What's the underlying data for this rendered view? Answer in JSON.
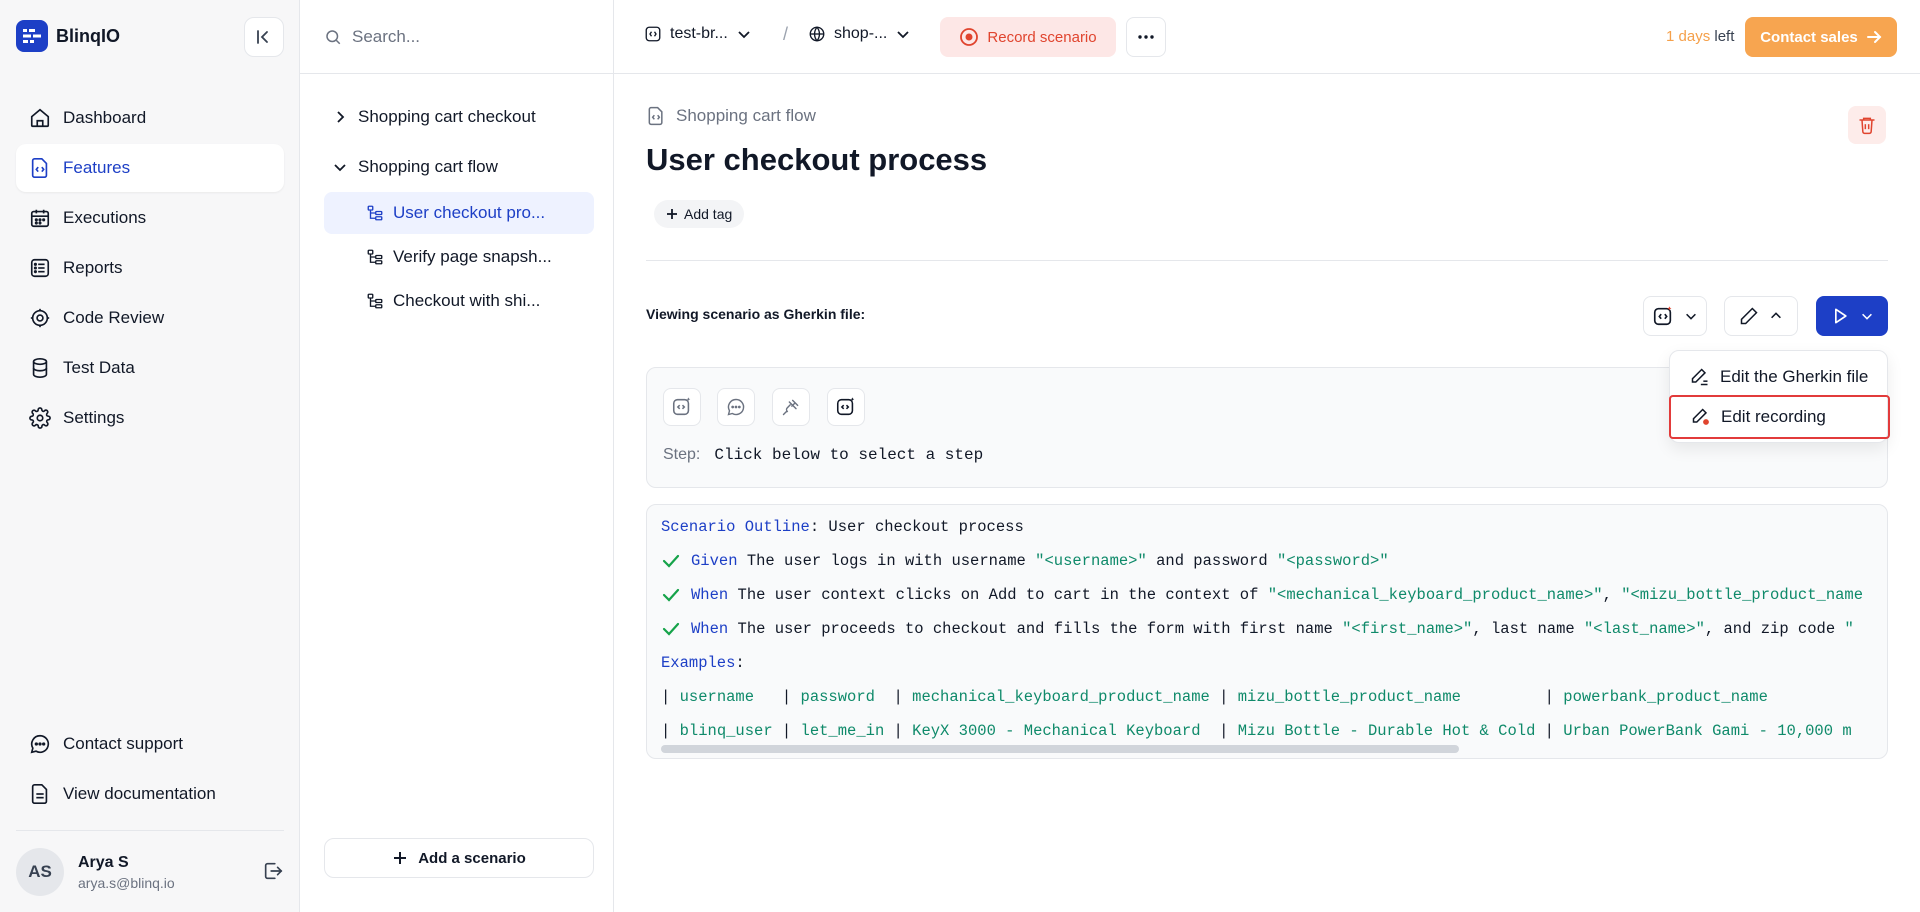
{
  "brand": {
    "name": "BlinqIO"
  },
  "nav": {
    "items": [
      {
        "label": "Dashboard",
        "icon": "home-icon"
      },
      {
        "label": "Features",
        "icon": "code-file-icon",
        "active": true
      },
      {
        "label": "Executions",
        "icon": "calendar-icon"
      },
      {
        "label": "Reports",
        "icon": "list-icon"
      },
      {
        "label": "Code Review",
        "icon": "gear-icon"
      },
      {
        "label": "Test Data",
        "icon": "database-icon"
      },
      {
        "label": "Settings",
        "icon": "settings-icon"
      }
    ],
    "bottom": [
      {
        "label": "Contact support",
        "icon": "chat-icon"
      },
      {
        "label": "View documentation",
        "icon": "document-icon"
      }
    ]
  },
  "user": {
    "initials": "AS",
    "name": "Arya S",
    "email": "arya.s@blinq.io"
  },
  "search": {
    "placeholder": "Search..."
  },
  "tree": {
    "groups": [
      {
        "label": "Shopping cart checkout",
        "expanded": false
      },
      {
        "label": "Shopping cart flow",
        "expanded": true
      }
    ],
    "children": [
      {
        "label": "User checkout pro...",
        "active": true
      },
      {
        "label": "Verify page snapsh..."
      },
      {
        "label": "Checkout with shi..."
      }
    ],
    "add_label": "Add a scenario"
  },
  "topbar": {
    "project": "test-br...",
    "environment": "shop-...",
    "separator": "/",
    "record_label": "Record scenario",
    "trial_number": "1 days",
    "trial_suffix": " left",
    "contact_label": "Contact sales"
  },
  "main": {
    "feature_name": "Shopping cart flow",
    "title": "User checkout process",
    "add_tag_label": "Add tag",
    "viewing_label": "Viewing scenario as Gherkin file:",
    "step_label": "Step:",
    "step_text": "Click below to select a step"
  },
  "gherkin": {
    "outline_kw": "Scenario Outline",
    "outline_rest": ": User checkout process",
    "steps": [
      {
        "kw": "Given",
        "parts": [
          {
            "t": " The user logs in with username "
          },
          {
            "s": "\"<username>\""
          },
          {
            "t": " and password "
          },
          {
            "s": "\"<password>\""
          }
        ]
      },
      {
        "kw": "When",
        "parts": [
          {
            "t": " The user context clicks on Add to cart in the context of "
          },
          {
            "s": "\"<mechanical_keyboard_product_name>\""
          },
          {
            "t": ", "
          },
          {
            "s": "\"<mizu_bottle_product_name"
          }
        ]
      },
      {
        "kw": "When",
        "parts": [
          {
            "t": " The user proceeds to checkout and fills the form with first name "
          },
          {
            "s": "\"<first_name>\""
          },
          {
            "t": ", last name "
          },
          {
            "s": "\"<last_name>\""
          },
          {
            "t": ", and zip code "
          },
          {
            "s": "\""
          }
        ]
      }
    ],
    "examples_kw": "Examples",
    "examples_rest": ":",
    "header_row": [
      "username  ",
      "password ",
      "mechanical_keyboard_product_name",
      "mizu_bottle_product_name        ",
      "powerbank_product_name"
    ],
    "data_row": [
      "blinq_user",
      "let_me_in",
      "KeyX 3000 - Mechanical Keyboard ",
      "Mizu Bottle - Durable Hot & Cold",
      "Urban PowerBank Gami - 10,000 m"
    ]
  },
  "dropdown": {
    "items": [
      {
        "label": "Edit the Gherkin file",
        "icon": "pen-lines-icon"
      },
      {
        "label": "Edit recording",
        "icon": "pen-record-icon",
        "selected": true
      }
    ]
  },
  "colors": {
    "accent": "#1d3fc6",
    "record": "#e0442e",
    "cta": "#f7a550",
    "string": "#0f8a6a"
  }
}
